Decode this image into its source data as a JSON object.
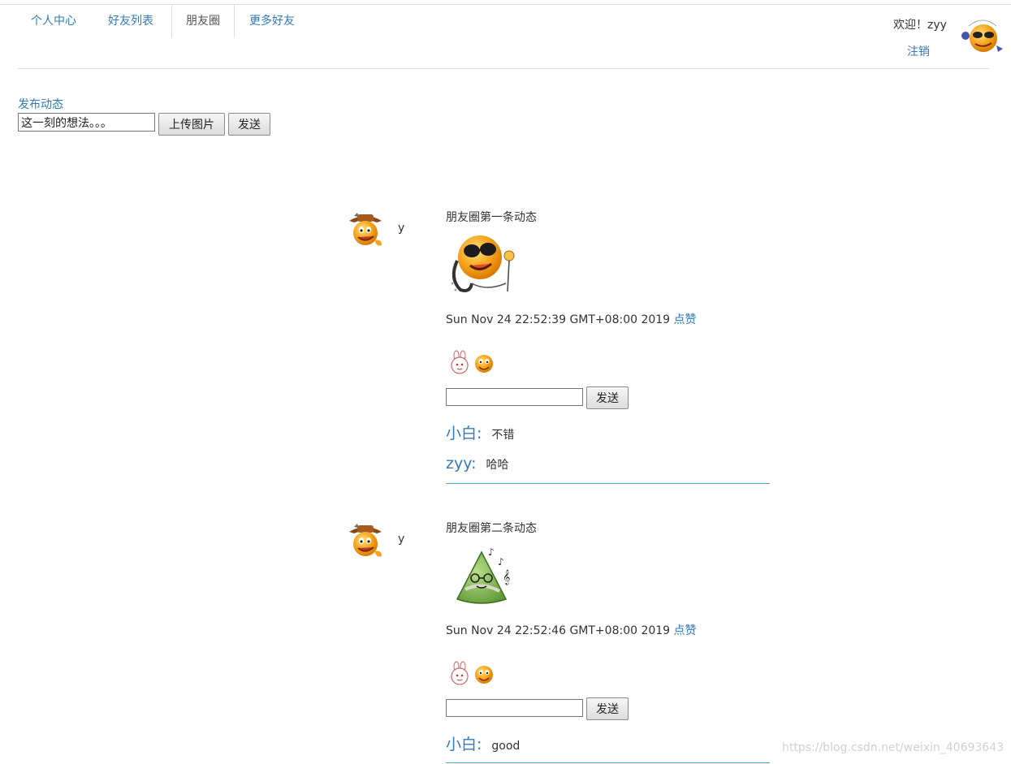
{
  "nav": {
    "tabs": [
      {
        "label": "个人中心"
      },
      {
        "label": "好友列表"
      },
      {
        "label": "朋友圈"
      },
      {
        "label": "更多好友"
      }
    ],
    "welcome": "欢迎！zyy",
    "logout": "注销",
    "user_avatar_icon": "sunglasses-emoji-avatar-icon"
  },
  "publish": {
    "label": "发布动态",
    "input_value": "这一刻的想法。。。",
    "upload_button": "上传图片",
    "send_button": "发送"
  },
  "posts": [
    {
      "author": "y",
      "author_avatar_icon": "cowboy-emoji-icon",
      "text": "朋友圈第一条动态",
      "image_icon": "goggles-emoji-image",
      "time": "Sun Nov 24 22:52:39 GMT+08:00 2019",
      "like_label": "点赞",
      "liker_icons": [
        "bunny-icon",
        "emoji-icon"
      ],
      "comment_input": "",
      "send_button": "发送",
      "comments": [
        {
          "user": "小白:",
          "text": "不错"
        },
        {
          "user": "zyy:",
          "text": "哈哈"
        }
      ]
    },
    {
      "author": "y",
      "author_avatar_icon": "cowboy-emoji-icon",
      "text": "朋友圈第二条动态",
      "image_icon": "singing-zongzi-image",
      "time": "Sun Nov 24 22:52:46 GMT+08:00 2019",
      "like_label": "点赞",
      "liker_icons": [
        "bunny-icon",
        "emoji-icon"
      ],
      "comment_input": "",
      "send_button": "发送",
      "comments": [
        {
          "user": "小白:",
          "text": "good"
        }
      ]
    }
  ],
  "watermark": "https://blog.csdn.net/weixin_40693643",
  "colors": {
    "link": "#337ab7",
    "divider": "#4aa3c6",
    "text": "#333333"
  }
}
